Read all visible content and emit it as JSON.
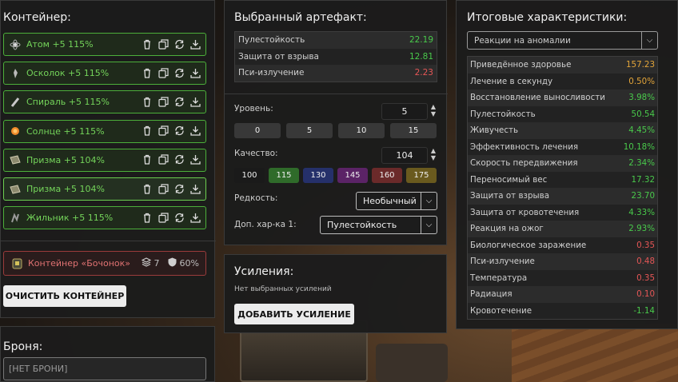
{
  "colors": {
    "green": "#49c94b",
    "red": "#e55656",
    "orange": "#e3a53a"
  },
  "container": {
    "title": "Контейнер:",
    "artifacts": [
      {
        "name": "Атом +5 115%",
        "icon": "atom-artifact-icon"
      },
      {
        "name": "Осколок +5 115%",
        "icon": "shard-artifact-icon"
      },
      {
        "name": "Спираль +5 115%",
        "icon": "spiral-artifact-icon"
      },
      {
        "name": "Солнце +5 115%",
        "icon": "sun-artifact-icon"
      },
      {
        "name": "Призма +5 104%",
        "icon": "prism-artifact-icon"
      },
      {
        "name": "Призма +5 104%",
        "icon": "prism-artifact-icon"
      },
      {
        "name": "Жильник +5 115%",
        "icon": "vein-artifact-icon"
      }
    ],
    "barrel": {
      "name": "Контейнер «Бочонок»",
      "slots": "7",
      "protection": "60%"
    },
    "clear_label": "ОЧИСТИТЬ КОНТЕЙНЕР"
  },
  "armor": {
    "title": "Броня:",
    "value": "[НЕТ БРОНИ]"
  },
  "selected": {
    "title": "Выбранный артефакт:",
    "stats": [
      {
        "label": "Пулестойкость",
        "value": "22.19",
        "color": "green"
      },
      {
        "label": "Защита от взрыва",
        "value": "12.81",
        "color": "green"
      },
      {
        "label": "Пси-излучение",
        "value": "2.23",
        "color": "red"
      }
    ],
    "level_label": "Уровень:",
    "level_value": "5",
    "level_presets": [
      "0",
      "5",
      "10",
      "15"
    ],
    "quality_label": "Качество:",
    "quality_value": "104",
    "quality_presets": [
      {
        "label": "100",
        "bg": "#1a1a1a"
      },
      {
        "label": "115",
        "bg": "#2f6b2a"
      },
      {
        "label": "130",
        "bg": "#25306a"
      },
      {
        "label": "145",
        "bg": "#5b2366"
      },
      {
        "label": "160",
        "bg": "#6b2a2a"
      },
      {
        "label": "175",
        "bg": "#6a5a1e"
      }
    ],
    "rarity_label": "Редкость:",
    "rarity_value": "Необычный",
    "extra_label": "Доп. хар-ка 1:",
    "extra_value": "Пулестойкость"
  },
  "boosts": {
    "title": "Усиления:",
    "empty_text": "Нет выбранных усилений",
    "add_label": "ДОБАВИТЬ УСИЛЕНИЕ"
  },
  "totals": {
    "title": "Итоговые характеристики:",
    "filter": "Реакции на аномалии",
    "rows": [
      {
        "label": "Приведённое здоровье",
        "value": "157.23",
        "color": "orange"
      },
      {
        "label": "Лечение в секунду",
        "value": "0.50%",
        "color": "orange"
      },
      {
        "label": "Восстановление выносливости",
        "value": "3.98%",
        "color": "green"
      },
      {
        "label": "Пулестойкость",
        "value": "50.54",
        "color": "green"
      },
      {
        "label": "Живучесть",
        "value": "4.45%",
        "color": "green"
      },
      {
        "label": "Эффективность лечения",
        "value": "10.18%",
        "color": "green"
      },
      {
        "label": "Скорость передвижения",
        "value": "2.34%",
        "color": "green"
      },
      {
        "label": "Переносимый вес",
        "value": "17.32",
        "color": "green"
      },
      {
        "label": "Защита от взрыва",
        "value": "23.70",
        "color": "green"
      },
      {
        "label": "Защита от кровотечения",
        "value": "4.33%",
        "color": "green"
      },
      {
        "label": "Реакция на ожог",
        "value": "2.93%",
        "color": "green"
      },
      {
        "label": "Биологическое заражение",
        "value": "0.35",
        "color": "red"
      },
      {
        "label": "Пси-излучение",
        "value": "0.48",
        "color": "red"
      },
      {
        "label": "Температура",
        "value": "0.35",
        "color": "red"
      },
      {
        "label": "Радиация",
        "value": "0.10",
        "color": "red"
      },
      {
        "label": "Кровотечение",
        "value": "-1.14",
        "color": "green"
      }
    ]
  }
}
